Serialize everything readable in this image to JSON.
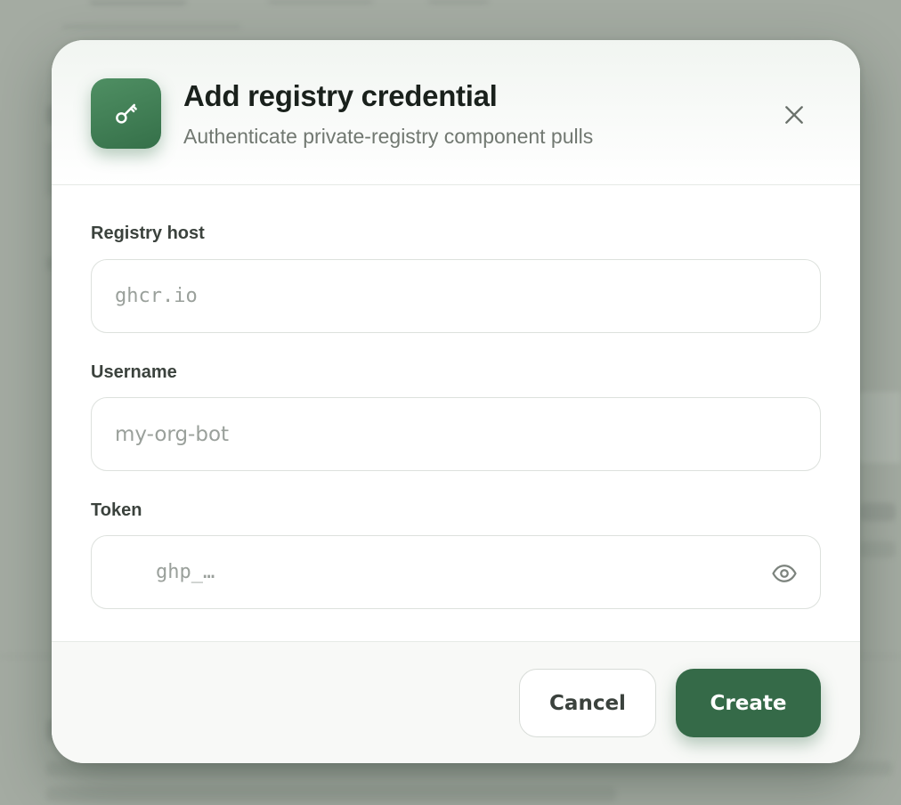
{
  "modal": {
    "title": "Add registry credential",
    "subtitle": "Authenticate private-registry component pulls",
    "header_icon": "key-icon",
    "close_icon": "close-icon"
  },
  "form": {
    "host": {
      "label": "Registry host",
      "placeholder": "ghcr.io",
      "value": ""
    },
    "username": {
      "label": "Username",
      "placeholder": "my-org-bot",
      "value": ""
    },
    "token": {
      "label": "Token",
      "placeholder": "ghp_…",
      "value": "",
      "toggle_icon": "eye-icon"
    }
  },
  "footer": {
    "cancel_label": "Cancel",
    "create_label": "Create"
  },
  "colors": {
    "accent": "#356a48",
    "accent_light": "#4f8f63",
    "overlay": "#a4aba2",
    "title": "#1a211c",
    "muted": "#717871"
  }
}
